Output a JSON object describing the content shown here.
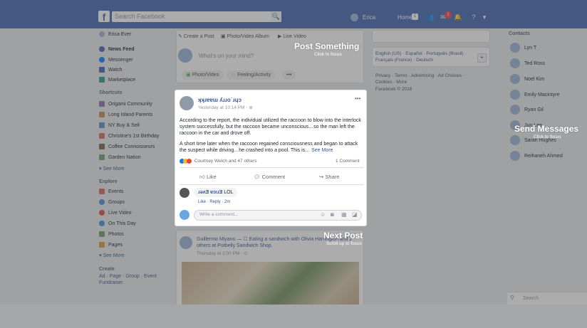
{
  "topbar": {
    "logo": "f",
    "search_placeholder": "Search Facebook",
    "search_icon": "🔍",
    "user_name": "Erica",
    "home_label": "Home",
    "home_count": "1",
    "notif_count": "1",
    "friends_icon": "👥",
    "messages_icon": "✉",
    "notif_icon": "🔔",
    "help_icon": "?",
    "menu_icon": "▾"
  },
  "sidebar": {
    "profile": "Erica Ever",
    "items": [
      "News Feed",
      "Messenger",
      "Watch",
      "Marketplace"
    ],
    "shortcuts_head": "Shortcuts",
    "shortcuts": [
      "Origami Community",
      "Long Island Parents",
      "NY Buy & Sell",
      "Christine's 1st Birthday",
      "Coffee Connoisseurs",
      "Garden Nation"
    ],
    "see_more_1": "▾ See More",
    "explore_head": "Explore",
    "explore": [
      "Events",
      "Groups",
      "Live Video",
      "On This Day",
      "Photos",
      "Pages"
    ],
    "see_more_2": "▾ See More",
    "create_head": "Create",
    "create_links": "Ad · Page · Group · Event",
    "create_links_2": "Fundraiser"
  },
  "composer": {
    "tab_create": "✎ Create a Post",
    "tab_photo": "▣ Photo/Video Album",
    "tab_live": "▶ Live Video",
    "placeholder": "What's on your mind?",
    "photo_btn": "Photo/Video",
    "feeling_btn": "Feeling/Activity",
    "more": "•••"
  },
  "hints": {
    "post_something": "Post Something",
    "post_something_sub": "Click to focus",
    "send_messages": "Send Messages",
    "send_messages_sub": "Click to focus",
    "next_post": "Next Post",
    "next_post_sub": "Scroll up to focus"
  },
  "post": {
    "author": "ʞʞɹɐɐɯ ʎɹɹo˙ɹɥɔ",
    "meta": "Yesterday at 10:14 PM · ",
    "menu": "•••",
    "para1": "According to the report, the individual utilized the raccoon to blow into the interlock system successfully, but the raccoon became unconscious…so the man left the raccoon in the car and drove off.",
    "para2": "A short time later when the raccoon regained consciousness and began to attack the suspect while driving…he crashed into a pool. This is…",
    "see_more": "See More",
    "reactions_text": "Courtney Welch and 47 others",
    "comment_count": "1 Comment",
    "like": "Like",
    "comment": "Comment",
    "share": "Share",
    "reply_author": "ɹǝʌƎ ɐɔıɹƎ",
    "reply_text": "LOL",
    "reply_actions": "Like · Reply · 2m",
    "comment_placeholder": "Write a comment...",
    "comment_icons": [
      "☺",
      "◙",
      "▦",
      "◪"
    ]
  },
  "next_post": {
    "header": "Guillermo Miyano — ☐ Eating a sandwich with Olivia Harrington and 2 others at Potbelly Sandwich Shop.",
    "time": "Thursday at 2:00 PM · ⊙"
  },
  "right": {
    "lang_text": "English (US) · Español · Português (Brasil) · Français (France) · Deutsch",
    "add_lang": "+",
    "footer_links": "Privacy · Terms · Advertising · Ad Choices · Cookies · More",
    "copyright": "Facebook © 2018",
    "contacts_head": "Contacts",
    "contacts": [
      "Lyn T",
      "Ted Ross",
      "Noel Kim",
      "Emily Macintyre",
      "Ryan Gil",
      "Jun Lee",
      "Sarah Hughes",
      "Reihaneh Ahmed"
    ],
    "search_placeholder": "Search"
  },
  "colors": {
    "brand": "#4267b2",
    "link": "#385898",
    "like_blue": "#1877f2",
    "notif_red": "#fa3e3e"
  }
}
